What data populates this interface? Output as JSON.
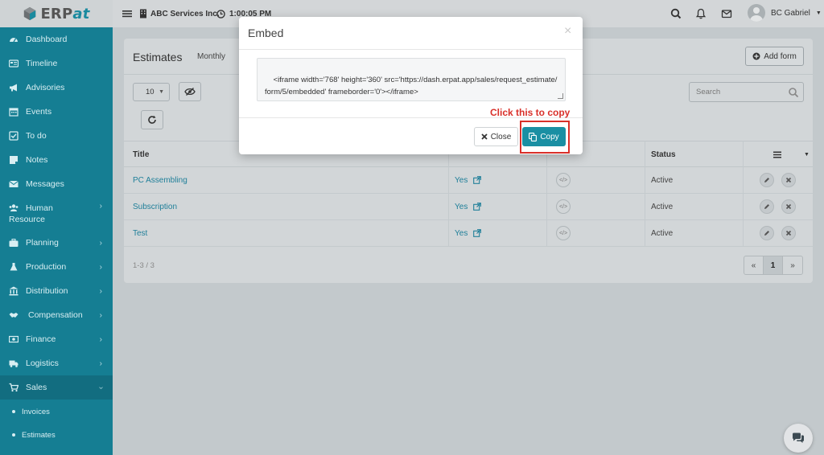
{
  "topbar": {
    "logo_text": "ERP",
    "logo_accent": "at",
    "company": "ABC Services Inc.",
    "time": "1:00:05 PM",
    "user_name": "BC Gabriel"
  },
  "sidebar": {
    "items": [
      {
        "label": "Dashboard",
        "icon": "dashboard-icon"
      },
      {
        "label": "Timeline",
        "icon": "timeline-icon"
      },
      {
        "label": "Advisories",
        "icon": "megaphone-icon"
      },
      {
        "label": "Events",
        "icon": "calendar-icon"
      },
      {
        "label": "To do",
        "icon": "checkbox-icon"
      },
      {
        "label": "Notes",
        "icon": "note-icon"
      },
      {
        "label": "Messages",
        "icon": "envelope-icon"
      },
      {
        "label": "Human",
        "label2": "Resource",
        "icon": "users-icon"
      },
      {
        "label": "Planning",
        "icon": "briefcase-icon"
      },
      {
        "label": "Production",
        "icon": "flask-icon"
      },
      {
        "label": "Distribution",
        "icon": "bank-icon"
      },
      {
        "label": "Compensation",
        "icon": "handshake-icon"
      },
      {
        "label": "Finance",
        "icon": "money-icon"
      },
      {
        "label": "Logistics",
        "icon": "truck-icon"
      },
      {
        "label": "Sales",
        "icon": "cart-icon"
      }
    ],
    "sub_items": [
      {
        "label": "Invoices"
      },
      {
        "label": "Estimates"
      }
    ]
  },
  "page": {
    "title": "Estimates",
    "tab_monthly": "Monthly",
    "add_form_label": "Add form",
    "page_size": "10",
    "search_placeholder": "Search",
    "columns": {
      "title": "Title",
      "status": "Status"
    },
    "rows": [
      {
        "title": "PC Assembling",
        "public": "Yes",
        "status": "Active"
      },
      {
        "title": "Subscription",
        "public": "Yes",
        "status": "Active"
      },
      {
        "title": "Test",
        "public": "Yes",
        "status": "Active"
      }
    ],
    "count_text": "1-3 / 3",
    "pager": {
      "prev": "«",
      "current": "1",
      "next": "»"
    }
  },
  "modal": {
    "title": "Embed",
    "embed_code": "<iframe width='768' height='360' src='https://dash.erpat.app/sales/request_estimate/form/5/embedded' frameborder='0'></iframe>",
    "close_label": "Close",
    "copy_label": "Copy"
  },
  "annotation": {
    "text": "Click this to copy",
    "color": "#d9302a"
  },
  "colors": {
    "sidebar": "#157e93",
    "accent": "#1a8fa3",
    "link": "#1f7f99"
  }
}
